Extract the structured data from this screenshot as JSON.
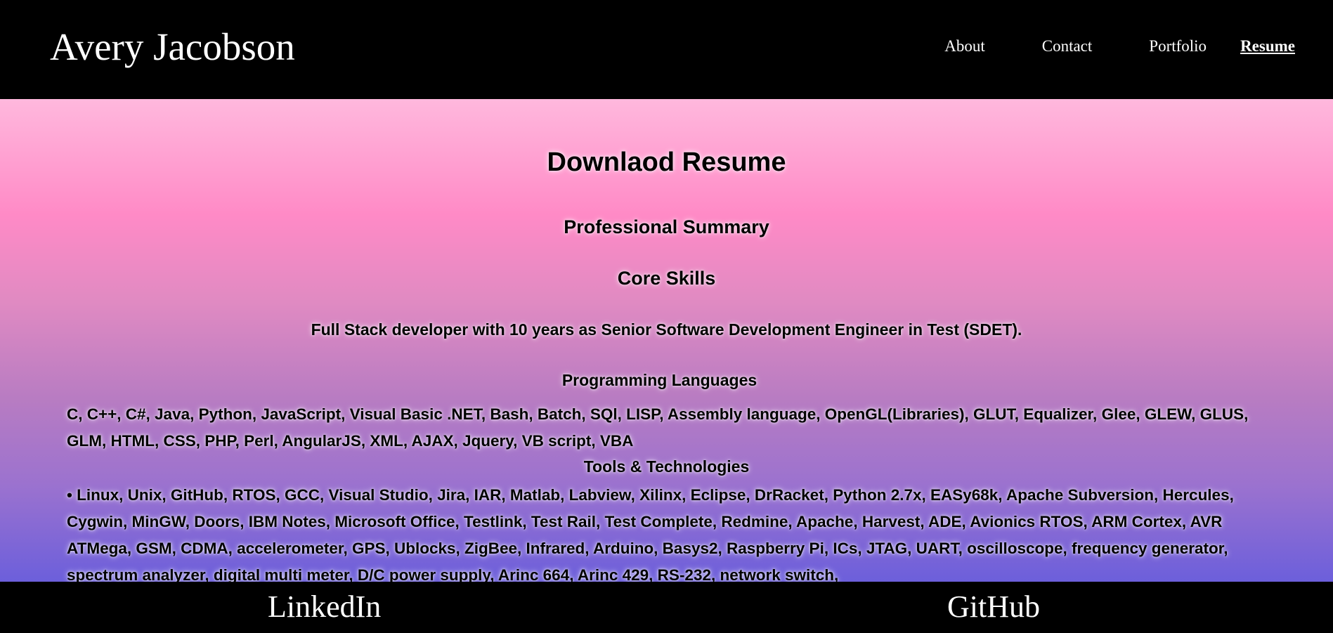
{
  "header": {
    "site_title": "Avery Jacobson",
    "nav": [
      {
        "label": "About"
      },
      {
        "label": "Contact"
      },
      {
        "label": "Portfolio"
      },
      {
        "label": "Resume",
        "active": true
      }
    ]
  },
  "main": {
    "download_heading": "Downlaod Resume",
    "professional_summary_heading": "Professional Summary",
    "core_skills_heading": "Core Skills",
    "summary_text": "Full Stack developer with 10 years as Senior Software Development Engineer in Test (SDET).",
    "programming_languages_heading": "Programming Languages",
    "programming_languages_text": "C, C++, C#, Java, Python, JavaScript, Visual Basic .NET, Bash, Batch, SQl, LISP, Assembly language, OpenGL(Libraries), GLUT, Equalizer, Glee, GLEW, GLUS, GLM, HTML, CSS, PHP, Perl, AngularJS, XML, AJAX, Jquery, VB script, VBA",
    "tools_heading": "Tools & Technologies",
    "tools_text": "• Linux, Unix, GitHub, RTOS, GCC, Visual Studio, Jira, IAR, Matlab, Labview, Xilinx, Eclipse, DrRacket, Python 2.7x, EASy68k, Apache Subversion, Hercules, Cygwin, MinGW, Doors, IBM Notes, Microsoft Office, Testlink, Test Rail, Test Complete, Redmine, Apache, Harvest, ADE, Avionics RTOS, ARM Cortex, AVR ATMega, GSM, CDMA, accelerometer, GPS, Ublocks, ZigBee, Infrared, Arduino, Basys2, Raspberry Pi, ICs, JTAG, UART, oscilloscope, frequency generator, spectrum analyzer, digital multi meter, D/C power supply, Arinc 664, Arinc 429, RS-232, network switch,"
  },
  "footer": {
    "linkedin_label": "LinkedIn",
    "github_label": "GitHub"
  },
  "colors": {
    "header_bg": "#000000",
    "footer_bg": "#000000",
    "gradient_top": "#ffb8dd",
    "gradient_mid": "#ff8ac6",
    "gradient_bottom": "#6c5fdb",
    "header_text": "#ffffff"
  }
}
